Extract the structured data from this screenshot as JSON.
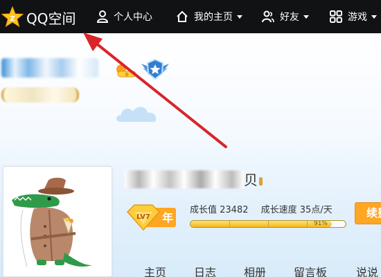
{
  "header": {
    "logo_icon": "qzone-star-icon",
    "logo_text": "QQ空间",
    "nav": [
      {
        "label": "个人中心",
        "icon": "person-icon",
        "dropdown": false
      },
      {
        "label": "我的主页",
        "icon": "home-icon",
        "dropdown": true
      },
      {
        "label": "好友",
        "icon": "friends-icon",
        "dropdown": true
      },
      {
        "label": "游戏",
        "icon": "grid-icon",
        "dropdown": true
      }
    ]
  },
  "profile": {
    "title_visible_tail": "贝",
    "yellow_badge_text": "6",
    "level_badge": {
      "level": "LV7",
      "unit": "年"
    },
    "growth_value_label": "成长值 23482",
    "growth_speed_label": "成长速度 35点/天",
    "progress": {
      "fraction": 0.91,
      "label": "91%"
    },
    "renew_button_label": "续费"
  },
  "tabs": [
    "主页",
    "日志",
    "相册",
    "留言板",
    "说说"
  ],
  "annotation": {
    "type": "arrow",
    "color": "#d9242a"
  },
  "colors": {
    "topbar": "#111213",
    "accent_orange": "#ffa623",
    "progress_gold": "#f3b719"
  }
}
